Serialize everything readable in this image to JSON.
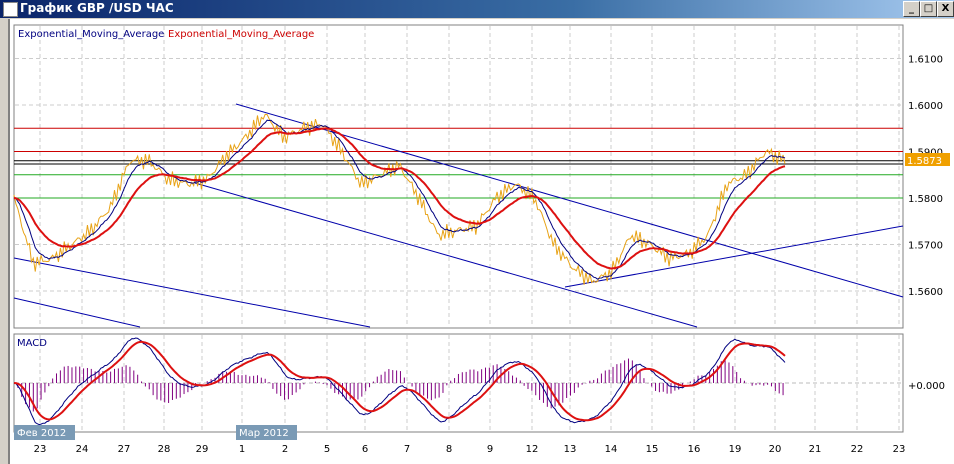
{
  "window": {
    "title": "График GBP /USD ЧАС",
    "buttons": [
      "_",
      "□",
      "X"
    ]
  },
  "legend": {
    "ema_blue": "Exponential_Moving_Average",
    "ema_red": "Exponential_Moving_Average"
  },
  "price_axis": {
    "labels": [
      "1.6100",
      "1.6000",
      "1.5900",
      "1.5800",
      "1.5700",
      "1.5600"
    ],
    "current": "1.5873"
  },
  "macd": {
    "title": "MACD",
    "zero_label": "+0.000"
  },
  "month_labels": [
    "Фев 2012",
    "Мар 2012"
  ],
  "dates": [
    "23",
    "24",
    "27",
    "28",
    "29",
    "1",
    "2",
    "5",
    "6",
    "7",
    "8",
    "9",
    "12",
    "13",
    "14",
    "15",
    "16",
    "19",
    "20",
    "21",
    "22",
    "23"
  ],
  "colors": {
    "price": "#e8a317",
    "ema_fast": "#000080",
    "ema_slow": "#dd1111",
    "macd_hist": "#800080",
    "channel": "#0000aa"
  },
  "chart_data": {
    "type": "line",
    "title": "GBP/USD H1",
    "ylim": [
      1.556,
      1.613
    ],
    "levels": {
      "red": [
        1.595,
        1.59
      ],
      "black": [
        1.588,
        1.5873
      ],
      "green": [
        1.585,
        1.58
      ]
    },
    "price": [
      1.58,
      1.566,
      1.567,
      1.57,
      1.573,
      1.578,
      1.588,
      1.588,
      1.584,
      1.583,
      1.584,
      1.589,
      1.593,
      1.598,
      1.593,
      1.595,
      1.596,
      1.59,
      1.583,
      1.585,
      1.587,
      1.58,
      1.572,
      1.573,
      1.574,
      1.58,
      1.583,
      1.58,
      1.57,
      1.565,
      1.562,
      1.564,
      1.572,
      1.57,
      1.567,
      1.568,
      1.572,
      1.583,
      1.585,
      1.59,
      1.588
    ]
  }
}
